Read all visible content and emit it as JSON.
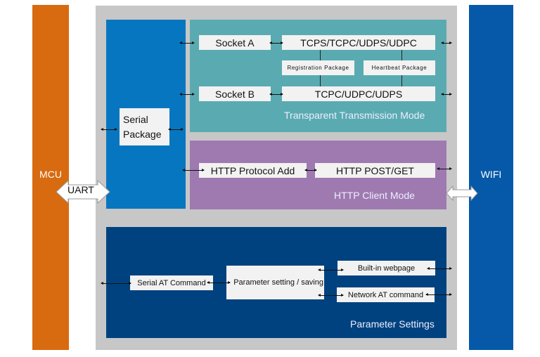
{
  "left_block": {
    "label": "MCU",
    "color": "#d86a0f"
  },
  "right_block": {
    "label": "WIFI",
    "color": "#0659a8"
  },
  "interface": {
    "label": "UART"
  },
  "serial_column": {
    "box_label_line1": "Serial",
    "box_label_line2": "Package",
    "color": "#0776c0"
  },
  "transparent_mode": {
    "title": "Transparent Transmission Mode",
    "color": "#5aabb1",
    "socket_a": "Socket A",
    "socket_a_protocols": "TCPS/TCPC/UDPS/UDPC",
    "registration": "Registration Package",
    "heartbeat": "Heartbeat Package",
    "socket_b": "Socket B",
    "socket_b_protocols": "TCPC/UDPC/UDPS"
  },
  "http_mode": {
    "title": "HTTP Client Mode",
    "color": "#9e7ab0",
    "protocol_add": "HTTP Protocol Add",
    "post_get": "HTTP POST/GET"
  },
  "parameter_settings": {
    "title": "Parameter Settings",
    "color": "#00427f",
    "serial_at": "Serial AT Command",
    "param_saving": "Parameter setting / saving",
    "webpage": "Built-in webpage",
    "network_at": "Network AT command"
  }
}
